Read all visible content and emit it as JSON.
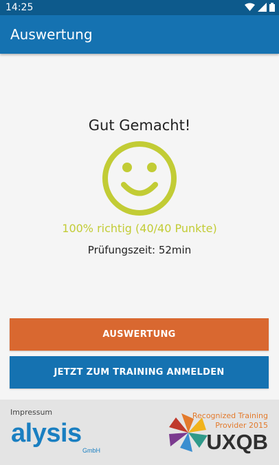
{
  "status_bar": {
    "time": "14:25",
    "icons": [
      "wifi-icon",
      "signal-icon",
      "battery-icon"
    ]
  },
  "app_bar": {
    "title": "Auswertung"
  },
  "result": {
    "heading": "Gut Gemacht!",
    "icon": "smiley-icon",
    "score_text": "100% richtig (40/40 Punkte)",
    "duration_text": "Prüfungszeit: 52min",
    "color": "#c2cc35"
  },
  "buttons": {
    "evaluation_label": "AUSWERTUNG",
    "training_label": "JETZT ZUM TRAINING ANMELDEN"
  },
  "footer": {
    "impressum_label": "Impressum",
    "alysis_logo": "alysis",
    "alysis_sub": "GmbH",
    "uxqb_line1": "Recognized Training",
    "uxqb_line2": "Provider 2015",
    "uxqb_word": "UXQB"
  },
  "colors": {
    "status_bar": "#0d5a8c",
    "app_bar": "#1572b1",
    "button_evaluation": "#d96830",
    "button_training": "#1572b1",
    "brand_alysis": "#1a7fc1",
    "brand_uxqb": "#e37a2c"
  }
}
